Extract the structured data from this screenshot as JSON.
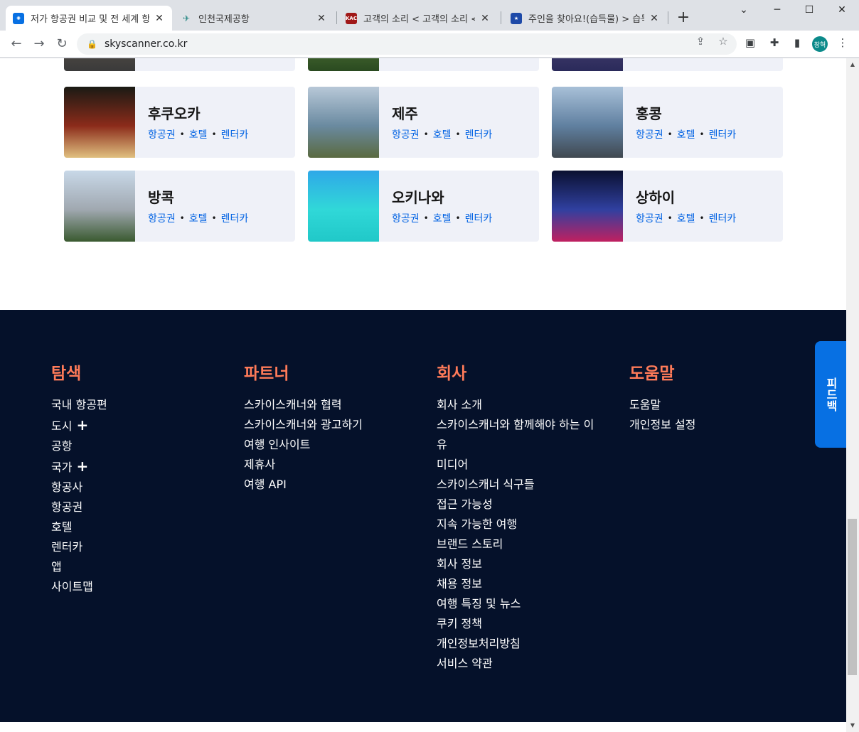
{
  "browser": {
    "tabs": [
      {
        "title": "저가 항공권 비교 및 전 세계 항",
        "favicon_color": "#0770e3",
        "active": true
      },
      {
        "title": "인천국제공항",
        "favicon_color": "#2e8b88",
        "active": false
      },
      {
        "title": "고객의 소리 < 고객의 소리 < 고",
        "favicon_color": "#a01818",
        "favicon_text": "KAC",
        "active": false
      },
      {
        "title": "주인을 찾아요!(습득물) > 습득",
        "favicon_color": "#1e4aa8",
        "active": false
      }
    ],
    "url": "skyscanner.co.kr",
    "profile_label": "창혁"
  },
  "cities": [
    {
      "name": "후쿠오카",
      "img_colors": [
        "#1a1a14",
        "#8b2b1a",
        "#e0c080"
      ]
    },
    {
      "name": "제주",
      "img_colors": [
        "#b8c8d8",
        "#6a8aa0",
        "#5a6a40"
      ]
    },
    {
      "name": "홍콩",
      "img_colors": [
        "#a8c0d8",
        "#6080a0",
        "#404850"
      ]
    },
    {
      "name": "방콕",
      "img_colors": [
        "#c8d8e8",
        "#a0a8b0",
        "#3a5a30"
      ]
    },
    {
      "name": "오키나와",
      "img_colors": [
        "#2fa8e8",
        "#30d8d8",
        "#20c8c8"
      ]
    },
    {
      "name": "상하이",
      "img_colors": [
        "#0a1030",
        "#3040a0",
        "#c02060"
      ]
    }
  ],
  "city_links": {
    "flights": "항공권",
    "hotels": "호텔",
    "cars": "렌터카",
    "sep": "•"
  },
  "footer": {
    "columns": [
      {
        "heading": "탐색",
        "items": [
          {
            "label": "국내 항공편"
          },
          {
            "label": "도시",
            "expand": "+"
          },
          {
            "label": "공항"
          },
          {
            "label": "국가",
            "expand": "+"
          },
          {
            "label": "항공사"
          },
          {
            "label": "항공권"
          },
          {
            "label": "호텔"
          },
          {
            "label": "렌터카"
          },
          {
            "label": "앱"
          },
          {
            "label": "사이트맵"
          }
        ]
      },
      {
        "heading": "파트너",
        "items": [
          {
            "label": "스카이스캐너와 협력"
          },
          {
            "label": "스카이스캐너와 광고하기"
          },
          {
            "label": "여행 인사이트"
          },
          {
            "label": "제휴사"
          },
          {
            "label": "여행 API"
          }
        ]
      },
      {
        "heading": "회사",
        "items": [
          {
            "label": "회사 소개"
          },
          {
            "label": "스카이스캐너와 함께해야 하는 이"
          },
          {
            "label": "유"
          },
          {
            "label": "미디어"
          },
          {
            "label": "스카이스캐너 식구들"
          },
          {
            "label": "접근 가능성"
          },
          {
            "label": "지속 가능한 여행"
          },
          {
            "label": "브랜드 스토리"
          },
          {
            "label": "회사 정보"
          },
          {
            "label": "채용 정보"
          },
          {
            "label": "여행 특징 및 뉴스"
          },
          {
            "label": "쿠키 정책"
          },
          {
            "label": "개인정보처리방침"
          },
          {
            "label": "서비스 약관"
          }
        ]
      },
      {
        "heading": "도움말",
        "items": [
          {
            "label": "도움말"
          },
          {
            "label": "개인정보 설정"
          }
        ]
      }
    ],
    "colors": {
      "background": "#05112a",
      "heading": "#ff7b59"
    }
  },
  "feedback_label": "피드백"
}
